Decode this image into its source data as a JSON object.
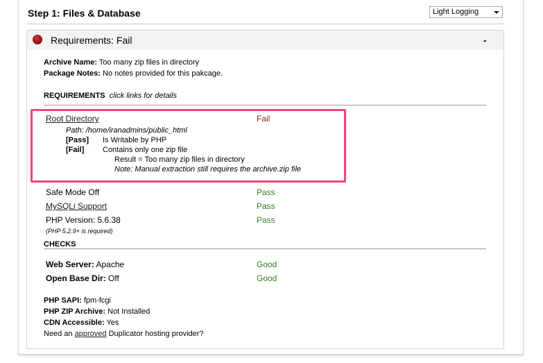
{
  "header": {
    "step_title": "Step 1: Files & Database",
    "logging_select": "Light Logging",
    "logging_icon": "chevron-down-icon"
  },
  "requirements_box": {
    "title": "Requirements: Fail",
    "status_color": "#9b1c1c",
    "collapse_label": "-",
    "archive_name_label": "Archive Name:",
    "archive_name_value": "Too many zip files in directory",
    "package_notes_label": "Package Notes:",
    "package_notes_value": "No notes provided for this pakcage.",
    "requirements_heading": "REQUIREMENTS",
    "requirements_hint": "click links for details",
    "root_directory": {
      "label": "Root Directory",
      "status": "Fail",
      "path": "Path: /home/iranadmins/public_html",
      "check1_tag": "[Pass]",
      "check1_text": "Is Writable by PHP",
      "check2_tag": "[Fail]",
      "check2_text": "Contains only one zip file",
      "result": "Result = Too many zip files in directory",
      "note": "Note: Manual extraction still requires the archive.zip file"
    },
    "safe_mode": {
      "label": "Safe Mode Off",
      "status": "Pass"
    },
    "mysqli": {
      "label": "MySQLi Support",
      "status": "Pass"
    },
    "php_version": {
      "label": "PHP Version: 5.6.38",
      "status": "Pass",
      "note": "(PHP 5.2.9+ is required)"
    },
    "checks_heading": "CHECKS",
    "web_server": {
      "label": "Web Server:",
      "value": "Apache",
      "status": "Good"
    },
    "open_base_dir": {
      "label": "Open Base Dir:",
      "value": "Off",
      "status": "Good"
    },
    "php_sapi": {
      "label": "PHP SAPI:",
      "value": "fpm-fcgi"
    },
    "php_zip": {
      "label": "PHP ZIP Archive:",
      "value": "Not Installed"
    },
    "cdn": {
      "label": "CDN Accessible:",
      "value": "Yes"
    },
    "hosting": {
      "prefix": "Need an",
      "link": "approved",
      "suffix": "Duplicator hosting provider?"
    }
  },
  "colors": {
    "fail": "#9b1c1c",
    "pass": "#2e7d1e",
    "highlight": "#f0447e"
  }
}
